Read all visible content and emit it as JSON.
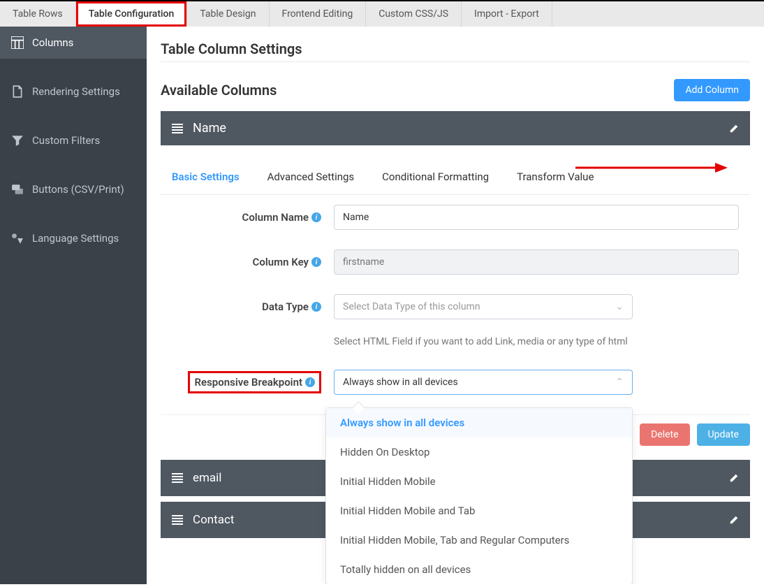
{
  "topTabs": [
    "Table Rows",
    "Table Configuration",
    "Table Design",
    "Frontend Editing",
    "Custom CSS/JS",
    "Import - Export"
  ],
  "sidebar": [
    {
      "label": "Columns"
    },
    {
      "label": "Rendering Settings"
    },
    {
      "label": "Custom Filters"
    },
    {
      "label": "Buttons (CSV/Print)"
    },
    {
      "label": "Language Settings"
    }
  ],
  "pageTitle": "Table Column Settings",
  "availableTitle": "Available Columns",
  "addColumnLabel": "Add Column",
  "columnHeader": "Name",
  "innerTabs": [
    "Basic Settings",
    "Advanced Settings",
    "Conditional Formatting",
    "Transform Value"
  ],
  "labels": {
    "columnName": "Column Name",
    "columnKey": "Column Key",
    "dataType": "Data Type",
    "breakpoint": "Responsive Breakpoint"
  },
  "fields": {
    "columnNameValue": "Name",
    "columnKeyPlaceholder": "firstname",
    "dataTypePlaceholder": "Select Data Type of this column",
    "dataTypeHelp": "Select HTML Field if you want to add Link, media or any type of html",
    "breakpointValue": "Always show in all devices"
  },
  "breakpointOptions": [
    "Always show in all devices",
    "Hidden On Desktop",
    "Initial Hidden Mobile",
    "Initial Hidden Mobile and Tab",
    "Initial Hidden Mobile, Tab and Regular Computers",
    "Totally hidden on all devices"
  ],
  "actions": {
    "delete": "Delete",
    "update": "Update"
  },
  "otherColumns": [
    "email",
    "Contact"
  ]
}
